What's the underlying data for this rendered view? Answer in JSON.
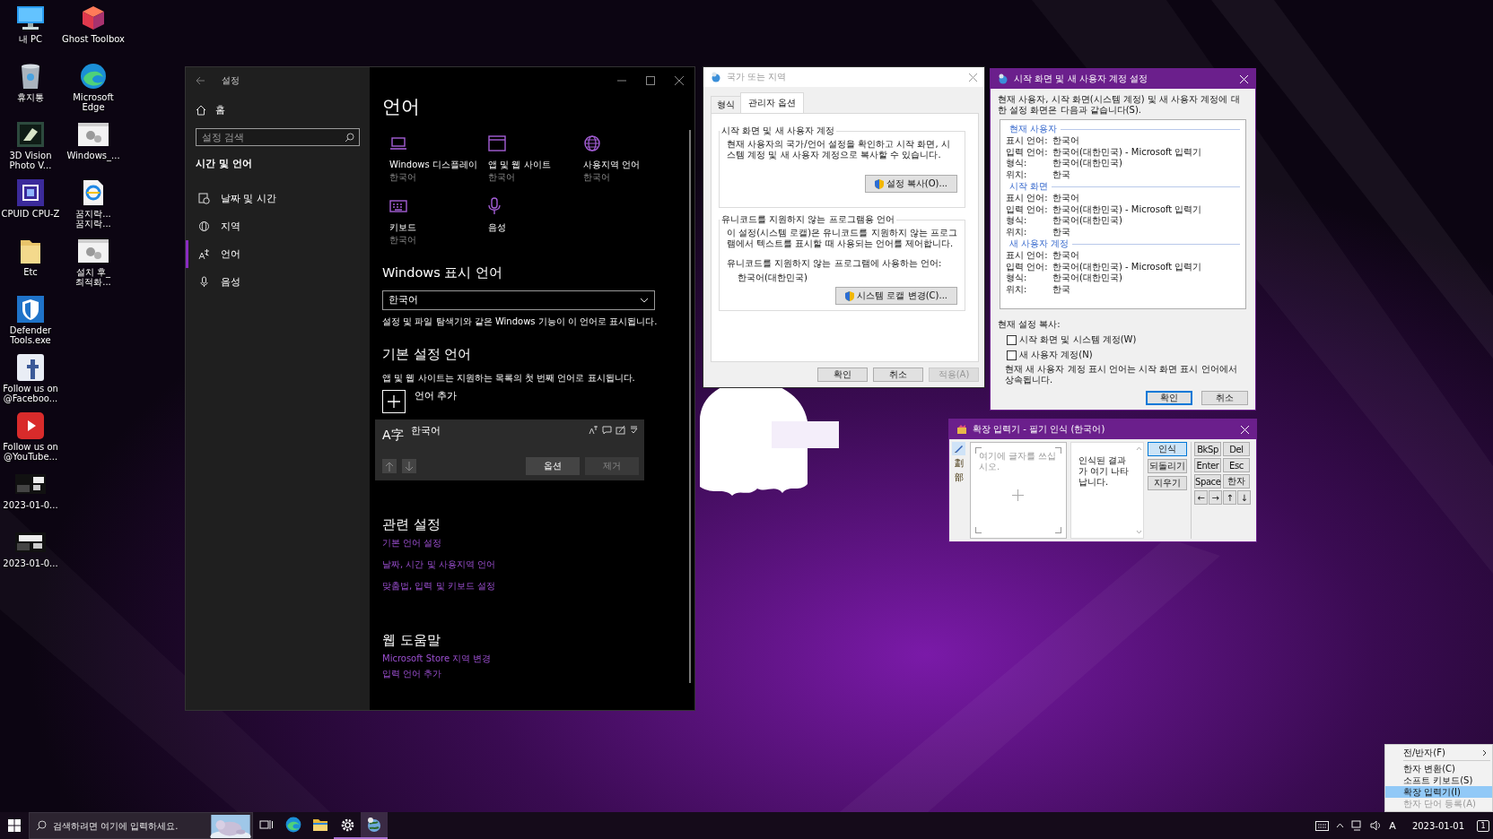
{
  "desktop": {
    "icon_columns": [
      [
        {
          "label": "내 PC"
        },
        {
          "label": "휴지통"
        },
        {
          "label": "3D Vision Photo V..."
        },
        {
          "label": "CPUID CPU-Z"
        },
        {
          "label": "Etc"
        },
        {
          "label": "Defender Tools.exe"
        },
        {
          "label": "Follow us on @Faceboo..."
        },
        {
          "label": "Follow us on @YouTube..."
        },
        {
          "label": "2023-01-0..."
        },
        {
          "label": "2023-01-0..."
        }
      ],
      [
        {
          "label": "Ghost Toolbox"
        },
        {
          "label": "Microsoft Edge"
        },
        {
          "label": "Windows_..."
        },
        {
          "label": "꿈지락... 꿈지락..."
        },
        {
          "label": "설치 후_최적화..."
        }
      ]
    ]
  },
  "settings": {
    "title": "설정",
    "home": "홈",
    "search_placeholder": "설정 검색",
    "section": "시간 및 언어",
    "nav": [
      {
        "label": "날짜 및 시간",
        "selected": false
      },
      {
        "label": "지역",
        "selected": false
      },
      {
        "label": "언어",
        "selected": true
      },
      {
        "label": "음성",
        "selected": false
      }
    ],
    "page_title": "언어",
    "tiles": [
      {
        "label": "Windows 디스플레이",
        "value": "한국어"
      },
      {
        "label": "앱 및 웹 사이트",
        "value": "한국어"
      },
      {
        "label": "사용지역 언어",
        "value": "한국어"
      },
      {
        "label": "키보드",
        "value": "한국어"
      },
      {
        "label": "음성"
      }
    ],
    "display_language": {
      "heading": "Windows 표시 언어",
      "value": "한국어",
      "description": "설정 및 파일 탐색기와 같은 Windows 기능이 이 언어로 표시됩니다."
    },
    "preferred": {
      "heading": "기본 설정 언어",
      "description": "앱 및 웹 사이트는 지원하는 목록의 첫 번째 언어로 표시됩니다.",
      "add_label": "언어 추가",
      "languages": [
        {
          "glyph": "A字",
          "name": "한국어",
          "options": "옵션",
          "remove": "제거",
          "remove_disabled": true
        }
      ]
    },
    "related": {
      "heading": "관련 설정",
      "links": [
        "기본 언어 설정",
        "날짜, 시간 및 사용지역 언어",
        "맞춤법, 입력 및 키보드 설정"
      ]
    },
    "help": {
      "heading": "웹 도움말",
      "links": [
        "Microsoft Store 지역 변경",
        "입력 언어 추가"
      ]
    }
  },
  "region_dialog": {
    "title": "국가 또는 지역",
    "active": false,
    "tabs": [
      {
        "label": "형식",
        "selected": false
      },
      {
        "label": "관리자 옵션",
        "selected": true
      }
    ],
    "groups": [
      {
        "legend": "시작 화면 및 새 사용자 계정",
        "text": "현재 사용자의 국가/언어 설정을 확인하고 시작 화면, 시스템 계정 및 새 사용자 계정으로 복사할 수 있습니다.",
        "button": "설정 복사(O)..."
      },
      {
        "legend": "유니코드를 지원하지 않는 프로그램용 언어",
        "text": "이 설정(시스템 로캘)은 유니코드를 지원하지 않는 프로그램에서 텍스트를 표시할 때 사용되는 언어를 제어합니다.",
        "label": "유니코드를 지원하지 않는 프로그램에 사용하는 언어:",
        "value": "한국어(대한민국)",
        "button": "시스템 로캘 변경(C)..."
      }
    ],
    "buttons": [
      {
        "label": "확인",
        "disabled": false
      },
      {
        "label": "취소",
        "disabled": false
      },
      {
        "label": "적용(A)",
        "disabled": true
      }
    ]
  },
  "copy_dialog": {
    "title": "시작 화면 및 새 사용자 계정 설정",
    "active": true,
    "intro": "현재 사용자, 시작 화면(시스템 계정) 및 새 사용자 계정에 대한 설정 화면은 다음과 같습니다(S).",
    "sections": [
      {
        "heading": "현재 사용자",
        "rows": [
          {
            "label": "표시 언어:",
            "value": "한국어"
          },
          {
            "label": "입력 언어:",
            "value": "한국어(대한민국) - Microsoft 입력기"
          },
          {
            "label": "형식:",
            "value": "한국어(대한민국)"
          },
          {
            "label": "위치:",
            "value": "한국"
          }
        ]
      },
      {
        "heading": "시작 화면",
        "rows": [
          {
            "label": "표시 언어:",
            "value": "한국어"
          },
          {
            "label": "입력 언어:",
            "value": "한국어(대한민국) - Microsoft 입력기"
          },
          {
            "label": "형식:",
            "value": "한국어(대한민국)"
          },
          {
            "label": "위치:",
            "value": "한국"
          }
        ]
      },
      {
        "heading": "새 사용자 계정",
        "rows": [
          {
            "label": "표시 언어:",
            "value": "한국어"
          },
          {
            "label": "입력 언어:",
            "value": "한국어(대한민국) - Microsoft 입력기"
          },
          {
            "label": "형식:",
            "value": "한국어(대한민국)"
          },
          {
            "label": "위치:",
            "value": "한국"
          }
        ]
      }
    ],
    "copy_label": "현재 설정 복사:",
    "checkboxes": [
      {
        "label": "시작 화면 및 시스템 계정(W)",
        "checked": false
      },
      {
        "label": "새 사용자 계정(N)",
        "checked": false
      }
    ],
    "note": "현재 새 사용자 계정 표시 언어는 시작 화면 표시 언어에서 상속됩니다.",
    "buttons": [
      {
        "label": "확인",
        "default": true
      },
      {
        "label": "취소",
        "default": false
      }
    ]
  },
  "ime_pad": {
    "title": "확장 입력기 - 필기 인식 (한국어)",
    "tools": [
      {
        "kind": "pen",
        "selected": true
      },
      {
        "kind": "char",
        "label": "劃",
        "selected": false
      },
      {
        "kind": "char",
        "label": "部",
        "selected": false
      }
    ],
    "hint": "여기에 글자를 쓰십시오.",
    "result": "인식된 결과가 여기 나타납니다.",
    "actions": [
      {
        "label": "인식",
        "selected": true
      },
      {
        "label": "되돌리기",
        "selected": false
      },
      {
        "label": "지우기",
        "selected": false
      }
    ],
    "keys": [
      "BkSp",
      "Del",
      "Enter",
      "Esc",
      "Space",
      "한자",
      "←",
      "→",
      "↑",
      "↓"
    ]
  },
  "context_menu": {
    "items": [
      {
        "kind": "item",
        "label": "전/반자(F)",
        "submenu": true,
        "selected": false,
        "disabled": false
      },
      {
        "kind": "separator"
      },
      {
        "kind": "item",
        "label": "한자 변환(C)",
        "submenu": false,
        "selected": false,
        "disabled": false
      },
      {
        "kind": "item",
        "label": "소프트 키보드(S)",
        "submenu": false,
        "selected": false,
        "disabled": false
      },
      {
        "kind": "item",
        "label": "확장 입력기(I)",
        "submenu": false,
        "selected": true,
        "disabled": false
      },
      {
        "kind": "item",
        "label": "한자 단어 등록(A)",
        "submenu": false,
        "selected": false,
        "disabled": true
      }
    ]
  },
  "taskbar": {
    "search_placeholder": "검색하려면 여기에 입력하세요.",
    "apps": [
      {
        "running": false,
        "selected": false
      },
      {
        "running": false,
        "selected": false
      },
      {
        "running": false,
        "selected": false
      },
      {
        "running": true,
        "selected": false
      },
      {
        "running": true,
        "selected": true
      }
    ],
    "tray": {
      "ime_mode": "A",
      "date": "2023-01-01",
      "notification_count": "1"
    }
  }
}
